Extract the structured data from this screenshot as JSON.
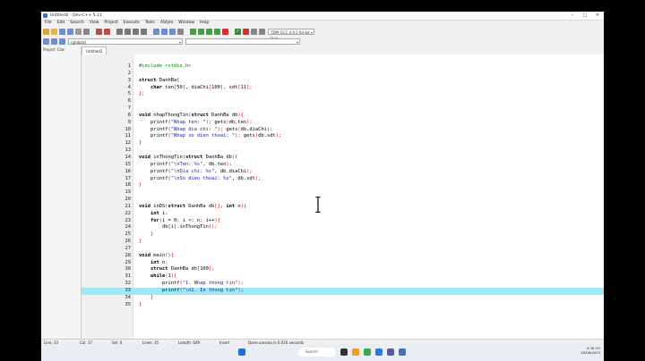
{
  "window": {
    "title": "Untitled2 - Dev-C++ 5.11"
  },
  "menu": [
    "File",
    "Edit",
    "Search",
    "View",
    "Project",
    "Execute",
    "Tools",
    "AStyle",
    "Window",
    "Help"
  ],
  "toolbar": {
    "compiler": "TDM-GCC 4.9.2 64-bit Debu",
    "globals": "(globals)"
  },
  "panel_tabs": [
    "Project",
    "Clas"
  ],
  "file_tab": "Untitled2",
  "code": [
    {
      "n": "1",
      "t": "#include <stdio.h>"
    },
    {
      "n": "2",
      "t": ""
    },
    {
      "n": "3",
      "t": "struct DanhBa{"
    },
    {
      "n": "4",
      "t": "    char ten[50], diaChi[100], sdt[11];"
    },
    {
      "n": "5",
      "t": "};"
    },
    {
      "n": "6",
      "t": ""
    },
    {
      "n": "7",
      "t": ""
    },
    {
      "n": "8",
      "t": "void nhapThongTin(struct DanhBa db){"
    },
    {
      "n": "9",
      "t": "    printf(\"Nhap ten: \"); gets(db.ten);"
    },
    {
      "n": "10",
      "t": "    printf(\"Nhap dia chi: \"); gets(db.diaChi);"
    },
    {
      "n": "11",
      "t": "    printf(\"Nhap so dien thoai: \"); gets(db.sdt);"
    },
    {
      "n": "12",
      "t": "}"
    },
    {
      "n": "13",
      "t": ""
    },
    {
      "n": "14",
      "t": "void inThongTin(struct DanhBa db){"
    },
    {
      "n": "15",
      "t": "    printf(\"\\nTen: %s\", db.ten);"
    },
    {
      "n": "16",
      "t": "    printf(\"\\nDia chi: %s\", db.diaChi);"
    },
    {
      "n": "17",
      "t": "    printf(\"\\nSo dien thoai: %s\", db.sdt);"
    },
    {
      "n": "18",
      "t": "}"
    },
    {
      "n": "19",
      "t": ""
    },
    {
      "n": "20",
      "t": ""
    },
    {
      "n": "21",
      "t": "void inDS(struct DanhBa db[], int n){"
    },
    {
      "n": "22",
      "t": "    int i;"
    },
    {
      "n": "23",
      "t": "    for(i = 0; i < n; i++){"
    },
    {
      "n": "24",
      "t": "        db[i].inThongTin();"
    },
    {
      "n": "25",
      "t": "    }"
    },
    {
      "n": "26",
      "t": "}"
    },
    {
      "n": "27",
      "t": ""
    },
    {
      "n": "28",
      "t": "void main(){"
    },
    {
      "n": "29",
      "t": "    int n;"
    },
    {
      "n": "30",
      "t": "    struct DanhBa db[100];"
    },
    {
      "n": "31",
      "t": "    while(1){"
    },
    {
      "n": "32",
      "t": "        printf(\"1. Nhap thong tin\");"
    },
    {
      "n": "33",
      "t": "        printf(\"\\n2. In thong tin\");"
    },
    {
      "n": "34",
      "t": "    }"
    },
    {
      "n": "35",
      "t": "}"
    }
  ],
  "highlighted_line": "33",
  "status": {
    "line": "Line: 33",
    "col": "Col: 37",
    "sel": "Sel: 0",
    "lines": "Lines: 35",
    "length": "Length: 649",
    "mode": "Insert",
    "message": "Done parsing in 0,016 seconds"
  },
  "taskbar": {
    "search": "Search",
    "time": "4:30 CH",
    "date": "18/06/2023"
  }
}
